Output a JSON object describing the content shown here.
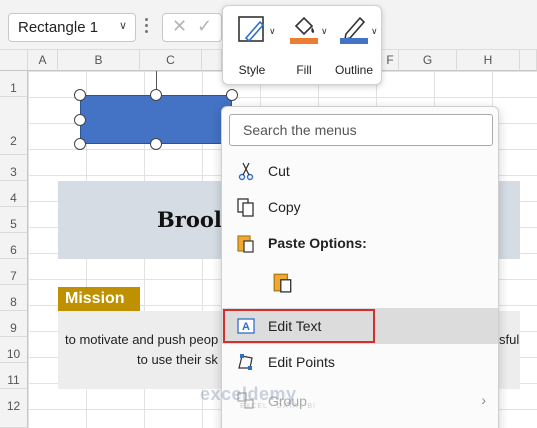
{
  "namebox": {
    "value": "Rectangle 1"
  },
  "columns": [
    "A",
    "B",
    "C",
    "D",
    "E",
    "F",
    "G",
    "H"
  ],
  "rows": [
    "1",
    "2",
    "3",
    "4",
    "5",
    "6",
    "7",
    "8",
    "9",
    "10",
    "11",
    "12"
  ],
  "sheet": {
    "title_partial": "Brool",
    "mission_label": "Mission",
    "body_line1": "to motivate and push peop",
    "body_line1_right": "sful",
    "body_line2": "to use their sk"
  },
  "mini_toolbar": {
    "style_label": "Style",
    "fill_label": "Fill",
    "outline_label": "Outline",
    "fill_color": "#ed7d31",
    "outline_color": "#4472c4"
  },
  "context_menu": {
    "search_placeholder": "Search the menus",
    "items": [
      {
        "label": "Cut",
        "icon": "scissors-icon"
      },
      {
        "label": "Copy",
        "icon": "copy-icon"
      },
      {
        "label": "Paste Options:",
        "icon": "clipboard-icon"
      },
      {
        "label": "Edit Text",
        "icon": "edit-text-icon"
      },
      {
        "label": "Edit Points",
        "icon": "edit-points-icon"
      },
      {
        "label": "Group",
        "icon": "group-icon"
      }
    ]
  },
  "watermark": {
    "text": "exceldemy",
    "sub": "EXCEL · DATA · BI"
  },
  "colors": {
    "shape_fill": "#4472c4",
    "title_band": "#d5dce4",
    "mission_bg": "#bf9000",
    "highlight": "#d32f2f"
  }
}
